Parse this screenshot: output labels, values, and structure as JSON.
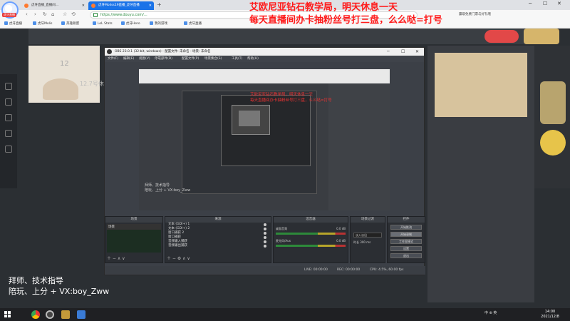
{
  "browser": {
    "tabs": [
      {
        "label": "虎牙直播_直播间…"
      },
      {
        "label": "虎牙Moliss19直播_虎牙直播"
      }
    ],
    "new_tab": "+",
    "address": "https://www.douyu.com/…",
    "right_note": "赢取免费门票与好礼哦",
    "bookmarks": [
      "虎牙直播",
      "虎牙Molis",
      "英雄联盟",
      "LoL Stats",
      "虎牙Hero",
      "我的游戏",
      "虎牙直播"
    ],
    "logo_badge": "虎牙直播"
  },
  "overlay": {
    "line1": "艾欧尼亚钻石教学局，明天休息一天",
    "line2": "每天直播间办卡抽粉丝号打三盘，么么哒=打号"
  },
  "page": {
    "room_number": "12",
    "room_title": "12.7号休"
  },
  "obs": {
    "title": "OBS 23.0.1 (32-bit, windows) - 配置文件: 未命名 - 场景: 未命名",
    "menu": [
      "文件(F)",
      "编辑(E)",
      "视图(V)",
      "停靠部件(D)",
      "配置文件(P)",
      "场景集合(S)",
      "工具(T)",
      "帮助(H)"
    ],
    "preview_text": {
      "line1": "艾欧尼亚钻石教学局，明天休息一天",
      "line2": "每天直播间办卡抽粉丝号打三盘，么么哒=打号"
    },
    "preview_caption": {
      "line1": "拜师、技术指导",
      "line2": "陪玩、上分 + VX:boy_Zww"
    },
    "docks": {
      "scenes": {
        "title": "场景",
        "items": [
          "场景"
        ]
      },
      "sources": {
        "title": "来源",
        "items": [
          "文本 (GDI+) 1",
          "文本 (GDI+) 2",
          "窗口捕获 2",
          "窗口捕获",
          "音频输入捕获",
          "音频输出捕获"
        ]
      },
      "mixer": {
        "title": "混音器",
        "channels": [
          {
            "name": "桌面音频",
            "db": "0.0 dB"
          },
          {
            "name": "麦克风/Aux",
            "db": "0.0 dB"
          }
        ]
      },
      "transitions": {
        "title": "场景过渡",
        "select": "淡入淡出",
        "duration_label": "时长",
        "duration": "300 ms"
      },
      "controls": {
        "title": "控件",
        "buttons": [
          "开始推流",
          "开始录制",
          "工作室模式",
          "设置",
          "退出"
        ]
      }
    },
    "status": {
      "live": "LIVE: 00:00:00",
      "rec": "REC: 00:00:00",
      "cpu": "CPU: 4.5%, 60.00 fps"
    }
  },
  "bottom_left": {
    "line1": "拜师、技术指导",
    "line2": "陪玩、上分 + VX:boy_Zww"
  },
  "taskbar": {
    "tray": "中 ⊕ 英",
    "time": "14:00",
    "date": "2021/12/8"
  },
  "colors": {
    "overlay_red": "#ff1a1a",
    "tab_active": "#1a73e8",
    "obs_bg": "#3c4047"
  }
}
